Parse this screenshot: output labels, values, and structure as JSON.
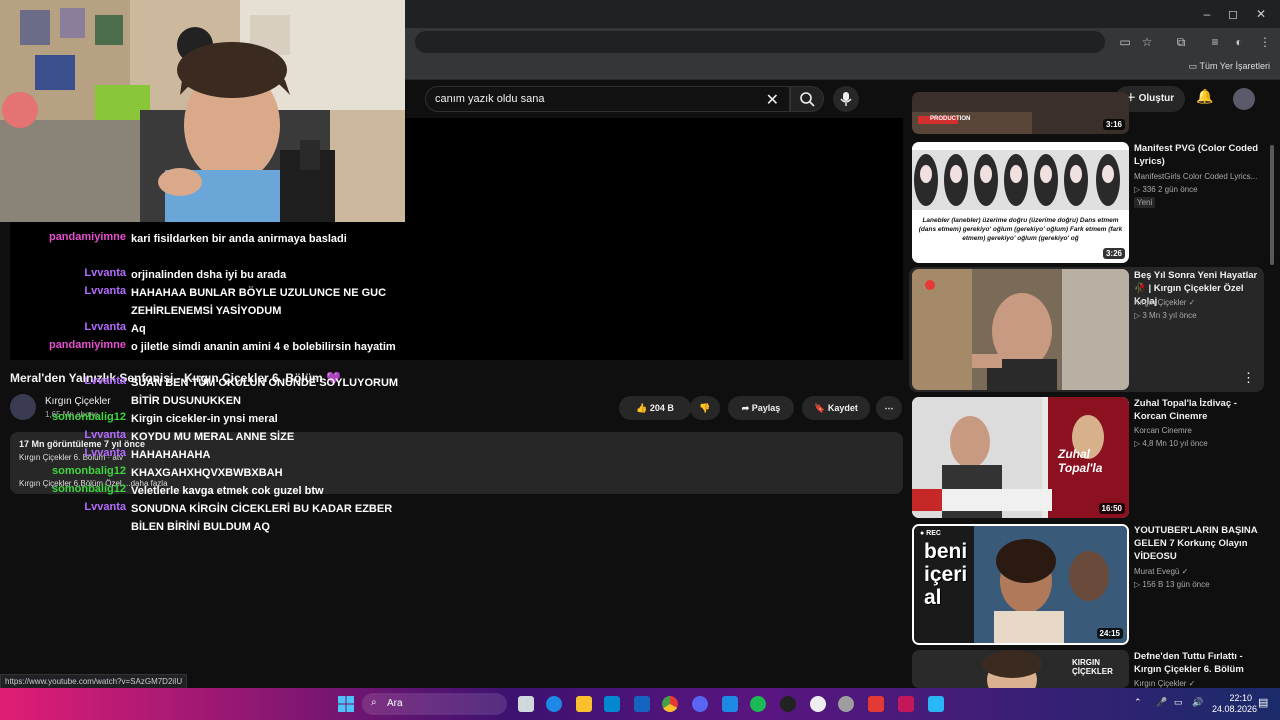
{
  "browser": {
    "window_controls": {
      "minimize": "–",
      "maximize": "◻",
      "close": "✕"
    },
    "bookmarks_label": "Tüm Yer İşaretleri",
    "status_url": "https://www.youtube.com/watch?v=SAzGM7D2iIU"
  },
  "youtube": {
    "search_query": "canım yazık oldu sana",
    "create_label": "Oluştur"
  },
  "video": {
    "title": "Meral'den Yalnızlık Senfonisi - Kırgın Çiçekler 6. Bölüm 💜",
    "channel": "Kırgın Çiçekler",
    "subscribers": "1,65 Mn abone",
    "like_count": "204 B",
    "share_label": "Paylaş",
    "save_label": "Kaydet",
    "views_line": "17 Mn görüntüleme  7 yıl önce",
    "desc_line": "Kırgın Çiçekler 6. Bölüm · atv",
    "desc_line3": "Kırgın Çiçekler 6.Bölüm Özel ...daha fazla"
  },
  "chat": [
    {
      "user": "pandamiyimne",
      "color": "#e84fd0",
      "msg": "kari fisildarken bir anda anirmaya basladi"
    },
    {
      "user": "Lvvanta",
      "color": "#b36cff",
      "msg": "orjinalinden dsha iyi bu arada"
    },
    {
      "user": "Lvvanta",
      "color": "#b36cff",
      "msg": "HAHAHAA BUNLAR BÖYLE UZULUNCE NE GUC ZEHİRLENEMSİ YASİYODUM"
    },
    {
      "user": "Lvvanta",
      "color": "#b36cff",
      "msg": "Aq"
    },
    {
      "user": "pandamiyimne",
      "color": "#e84fd0",
      "msg": "o jiletle simdi ananin amini 4 e bolebilirsin hayatim"
    },
    {
      "user": "Lvvanta",
      "color": "#b36cff",
      "msg": "SUAN BEN TÜM OKULUN ONUNDE SOYLUYORUM BİTİR DUSUNUKKEN"
    },
    {
      "user": "somonbalig12",
      "color": "#3fd43f",
      "msg": "Kirgin cicekler-in ynsi meral"
    },
    {
      "user": "Lvvanta",
      "color": "#b36cff",
      "msg": "KOYDU MU MERAL ANNE SİZE"
    },
    {
      "user": "Lvvanta",
      "color": "#b36cff",
      "msg": "HAHAHAHAHA"
    },
    {
      "user": "somonbalig12",
      "color": "#3fd43f",
      "msg": "KHAXGAHXHQVXBWBXBAH"
    },
    {
      "user": "somonbalig12",
      "color": "#3fd43f",
      "msg": "Veletlerle kavga etmek cok guzel btw"
    },
    {
      "user": "Lvvanta",
      "color": "#b36cff",
      "msg": "SONUDNA KİRGİN CİCEKLERİ BU KADAR EZBER BİLEN BİRİNİ BULDUM AQ"
    }
  ],
  "recommendations": [
    {
      "title": "",
      "channel": "",
      "meta": "",
      "duration": "3:16",
      "badge": ""
    },
    {
      "title": "Manifest PVG (Color Coded Lyrics)",
      "channel": "ManifestGirls Color Coded Lyrics...",
      "meta": "▷ 336  2 gün önce",
      "duration": "3:26",
      "badge": "Yeni"
    },
    {
      "title": "Beş Yıl Sonra Yeni Hayatlar 🥀 | Kırgın Çiçekler Özel Kolaj",
      "channel": "Kırgın Çiçekler ✓",
      "meta": "▷ 3 Mn  3 yıl önce",
      "duration": "",
      "badge": ""
    },
    {
      "title": "Zuhal Topal'la İzdivaç - Korcan Cinemre",
      "channel": "Korcan Cinemre",
      "meta": "▷ 4,8 Mn  10 yıl önce",
      "duration": "16:50",
      "badge": ""
    },
    {
      "title": "YOUTUBER'LARIN BAŞINA GELEN 7 Korkunç Olayın VİDEOSU",
      "channel": "Murat Evegü ✓",
      "meta": "▷ 156 B  13 gün önce",
      "duration": "24:15",
      "badge": ""
    },
    {
      "title": "Defne'den Tuttu Fırlattı - Kırgın Çiçekler 6. Bölüm",
      "channel": "Kırgın Çiçekler ✓",
      "meta": "",
      "duration": "",
      "badge": ""
    }
  ],
  "thumb_text": {
    "manifest_lyrics": "Lanebler (lanebler) üzerime doğru (üzerime doğru) Dans etmem (dans etmem) gerekiyo' oğlum (gerekiyo' oğlum) Fark etmem (fark etmem) gerekiyo' oğlum (gerekiyo' oğ",
    "beni_iceri_al": "beni içeri al",
    "rec_badge": "● REC",
    "zuhal_logo": "Zuhal Topal'la",
    "kirgin_logo": "KIRGIN ÇİÇEKLER",
    "production": "PRODUCTION"
  },
  "taskbar": {
    "search_label": "Ara",
    "time": "22:10",
    "date": "24.08.2026"
  }
}
